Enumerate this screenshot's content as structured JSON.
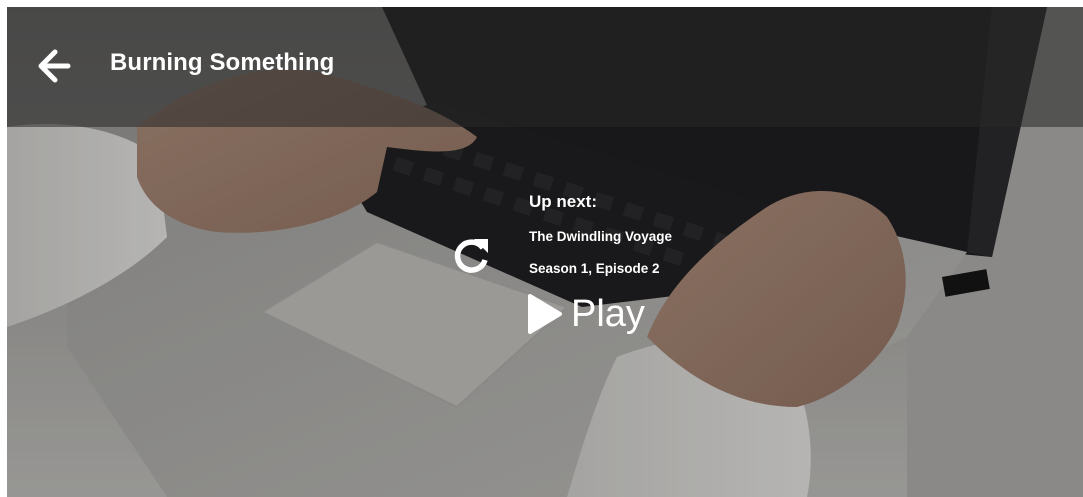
{
  "header": {
    "title": "Burning Something"
  },
  "up_next": {
    "label": "Up next:",
    "episode_title": "The Dwindling Voyage",
    "episode_info": "Season 1, Episode 2"
  },
  "controls": {
    "play_label": "Play"
  },
  "icons": {
    "back": "arrow-left-icon",
    "replay": "replay-icon",
    "play": "play-icon"
  },
  "colors": {
    "text": "#ffffff",
    "header_overlay": "rgba(40,40,40,0.55)"
  }
}
